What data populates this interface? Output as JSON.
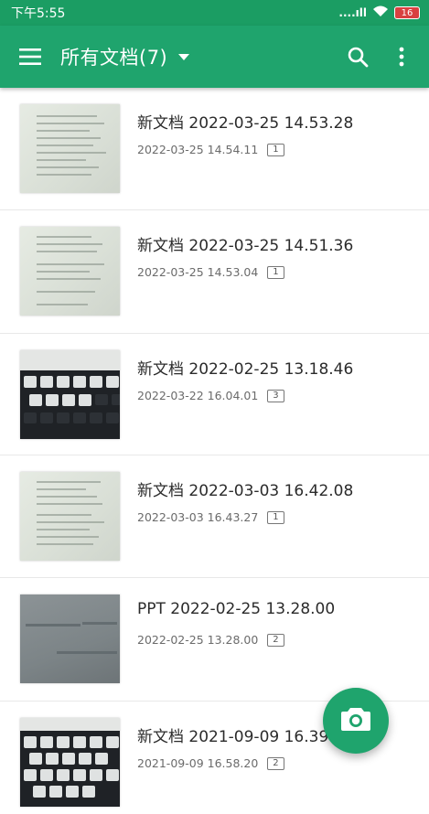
{
  "status_bar": {
    "time": "下午5:55",
    "signal": "....ıll",
    "battery": "16"
  },
  "app_bar": {
    "title": "所有文档(7)",
    "menu_icon": "hamburger-menu-icon",
    "dropdown_icon": "caret-down-icon",
    "search_icon": "search-icon",
    "more_icon": "more-vertical-icon"
  },
  "documents": [
    {
      "title": "新文档 2022-03-25 14.53.28",
      "date": "2022-03-25 14.54.11",
      "pages": "1",
      "thumb": "document"
    },
    {
      "title": "新文档 2022-03-25 14.51.36",
      "date": "2022-03-25 14.53.04",
      "pages": "1",
      "thumb": "document"
    },
    {
      "title": "新文档 2022-02-25 13.18.46",
      "date": "2022-03-22 16.04.01",
      "pages": "3",
      "thumb": "keyboard"
    },
    {
      "title": "新文档 2022-03-03 16.42.08",
      "date": "2022-03-03 16.43.27",
      "pages": "1",
      "thumb": "document"
    },
    {
      "title": "PPT 2022-02-25 13.28.00",
      "date": "2022-02-25 13.28.00",
      "pages": "2",
      "thumb": "slide"
    },
    {
      "title": "新文档 2021-09-09 16.39",
      "date": "2021-09-09 16.58.20",
      "pages": "2",
      "thumb": "keyboard"
    }
  ],
  "fab": {
    "icon": "camera-icon"
  },
  "colors": {
    "accent": "#1fa46d",
    "status_bar": "#1b9d63"
  }
}
